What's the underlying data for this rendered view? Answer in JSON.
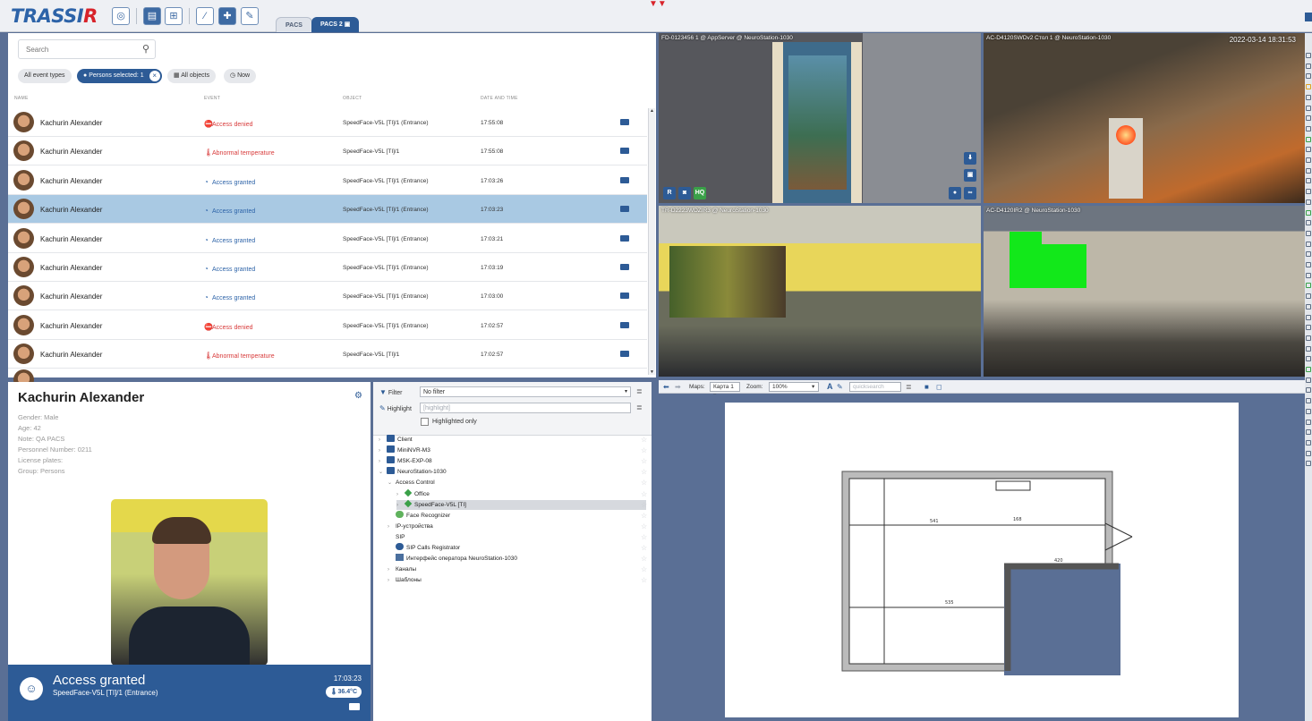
{
  "app": {
    "logo_main": "TRASSI",
    "logo_accent": "R",
    "tabs": [
      {
        "label": "PACS"
      },
      {
        "label": "PACS 2"
      }
    ]
  },
  "events": {
    "search_placeholder": "Search",
    "filters": {
      "all_event_types": "All event types",
      "persons_selected": "Persons selected: 1",
      "all_objects": "All objects",
      "now": "Now"
    },
    "columns": {
      "name": "NAME",
      "event": "EVENT",
      "object": "OBJECT",
      "datetime": "DATE AND TIME"
    },
    "rows": [
      {
        "name": "Kachurin Alexander",
        "event": "Access denied",
        "object": "SpeedFace-V5L [TI]/1 (Entrance)",
        "time": "17:55:08"
      },
      {
        "name": "Kachurin Alexander",
        "event": "Abnormal temperature",
        "object": "SpeedFace-V5L [TI]/1",
        "time": "17:55:08"
      },
      {
        "name": "Kachurin Alexander",
        "event": "Access granted",
        "object": "SpeedFace-V5L [TI]/1 (Entrance)",
        "time": "17:03:26"
      },
      {
        "name": "Kachurin Alexander",
        "event": "Access granted",
        "object": "SpeedFace-V5L [TI]/1 (Entrance)",
        "time": "17:03:23"
      },
      {
        "name": "Kachurin Alexander",
        "event": "Access granted",
        "object": "SpeedFace-V5L [TI]/1 (Entrance)",
        "time": "17:03:21"
      },
      {
        "name": "Kachurin Alexander",
        "event": "Access granted",
        "object": "SpeedFace-V5L [TI]/1 (Entrance)",
        "time": "17:03:19"
      },
      {
        "name": "Kachurin Alexander",
        "event": "Access granted",
        "object": "SpeedFace-V5L [TI]/1 (Entrance)",
        "time": "17:03:00"
      },
      {
        "name": "Kachurin Alexander",
        "event": "Access denied",
        "object": "SpeedFace-V5L [TI]/1 (Entrance)",
        "time": "17:02:57"
      },
      {
        "name": "Kachurin Alexander",
        "event": "Abnormal temperature",
        "object": "SpeedFace-V5L [TI]/1",
        "time": "17:02:57"
      }
    ]
  },
  "profile": {
    "name": "Kachurin Alexander",
    "gender": "Gender: Male",
    "age": "Age: 42",
    "note": "Note: QA PACS",
    "personnel_number": "Personnel Number: 0211",
    "license_plates": "License plates:",
    "group": "Group: Persons",
    "banner": {
      "status": "Access granted",
      "device": "SpeedFace-V5L [TI]/1 (Entrance)",
      "time": "17:03:23",
      "temperature": "36.4°C"
    }
  },
  "tree": {
    "filter_label": "Filter",
    "filter_value": "No filter",
    "highlight_label": "Highlight",
    "highlight_placeholder": "[highlight]",
    "highlighted_only": "Highlighted only",
    "nodes": [
      "Client",
      "MiniNVR-M3",
      "MSK-EXP-08",
      "NeuroStation-1030",
      "Access Control",
      "Office",
      "SpeedFace-V5L [TI]",
      "Face Recognizer",
      "IP-устройства",
      "SIP",
      "SIP Calls Registrator",
      "Интерфейс оператора NeuroStation-1030",
      "Каналы",
      "Шаблоны"
    ]
  },
  "cameras": {
    "cam1_label": "FD-0123456 1 @ AppServer @ NeuroStation-1030",
    "cam2_label": "AC-D4120SWDv2 Стол 1 @ NeuroStation-1030",
    "cam2_timestamp": "2022-03-14 18:31:53",
    "cam3_label": "TR-D2223WDZIR3 @ NeuroStation-1030",
    "cam4_label": "AC-D4120IR2 @ NeuroStation-1030",
    "buttons": {
      "r": "R",
      "hq": "HQ"
    }
  },
  "map": {
    "maps_label": "Maps:",
    "map_value": "Карта 1",
    "zoom_label": "Zoom:",
    "zoom_value": "100%",
    "search_placeholder": "quicksearch",
    "font_letter": "A"
  },
  "colors": {
    "accent": "#2d5b96",
    "denied": "#d83b3b",
    "granted": "#2d63a8",
    "selected_row": "#a9c9e3",
    "motion_mask": "#12e81a"
  }
}
